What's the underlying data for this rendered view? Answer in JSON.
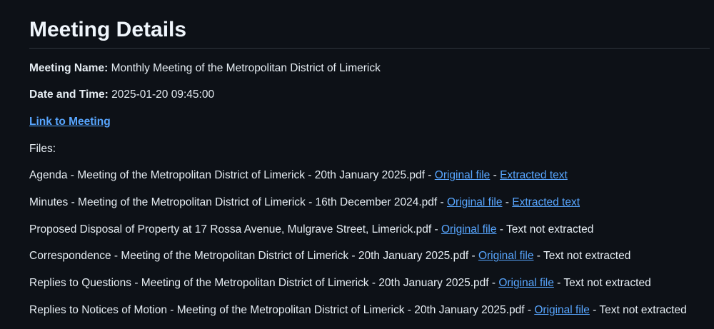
{
  "page": {
    "title": "Meeting Details"
  },
  "meeting": {
    "name_label": "Meeting Name:",
    "name_value": "Monthly Meeting of the Metropolitan District of Limerick",
    "date_label": "Date and Time:",
    "date_value": "2025-01-20 09:45:00",
    "link_label": "Link to Meeting",
    "files_label": "Files:"
  },
  "separator": " - ",
  "files": [
    {
      "name": "Agenda - Meeting of the Metropolitan District of Limerick - 20th January 2025.pdf",
      "original_label": "Original file",
      "extracted_label": "Extracted text",
      "not_extracted_text": null
    },
    {
      "name": "Minutes - Meeting of the Metropolitan District of Limerick - 16th December 2024.pdf",
      "original_label": "Original file",
      "extracted_label": "Extracted text",
      "not_extracted_text": null
    },
    {
      "name": "Proposed Disposal of Property at 17 Rossa Avenue, Mulgrave Street, Limerick.pdf",
      "original_label": "Original file",
      "extracted_label": null,
      "not_extracted_text": "Text not extracted"
    },
    {
      "name": "Correspondence - Meeting of the Metropolitan District of Limerick - 20th January 2025.pdf",
      "original_label": "Original file",
      "extracted_label": null,
      "not_extracted_text": "Text not extracted"
    },
    {
      "name": "Replies to Questions - Meeting of the Metropolitan District of Limerick - 20th January 2025.pdf",
      "original_label": "Original file",
      "extracted_label": null,
      "not_extracted_text": "Text not extracted"
    },
    {
      "name": "Replies to Notices of Motion - Meeting of the Metropolitan District of Limerick - 20th January 2025.pdf",
      "original_label": "Original file",
      "extracted_label": null,
      "not_extracted_text": "Text not extracted"
    }
  ],
  "colors": {
    "background": "#0d1117",
    "text": "#e6edf3",
    "link": "#58a6ff",
    "rule": "#30363d"
  }
}
